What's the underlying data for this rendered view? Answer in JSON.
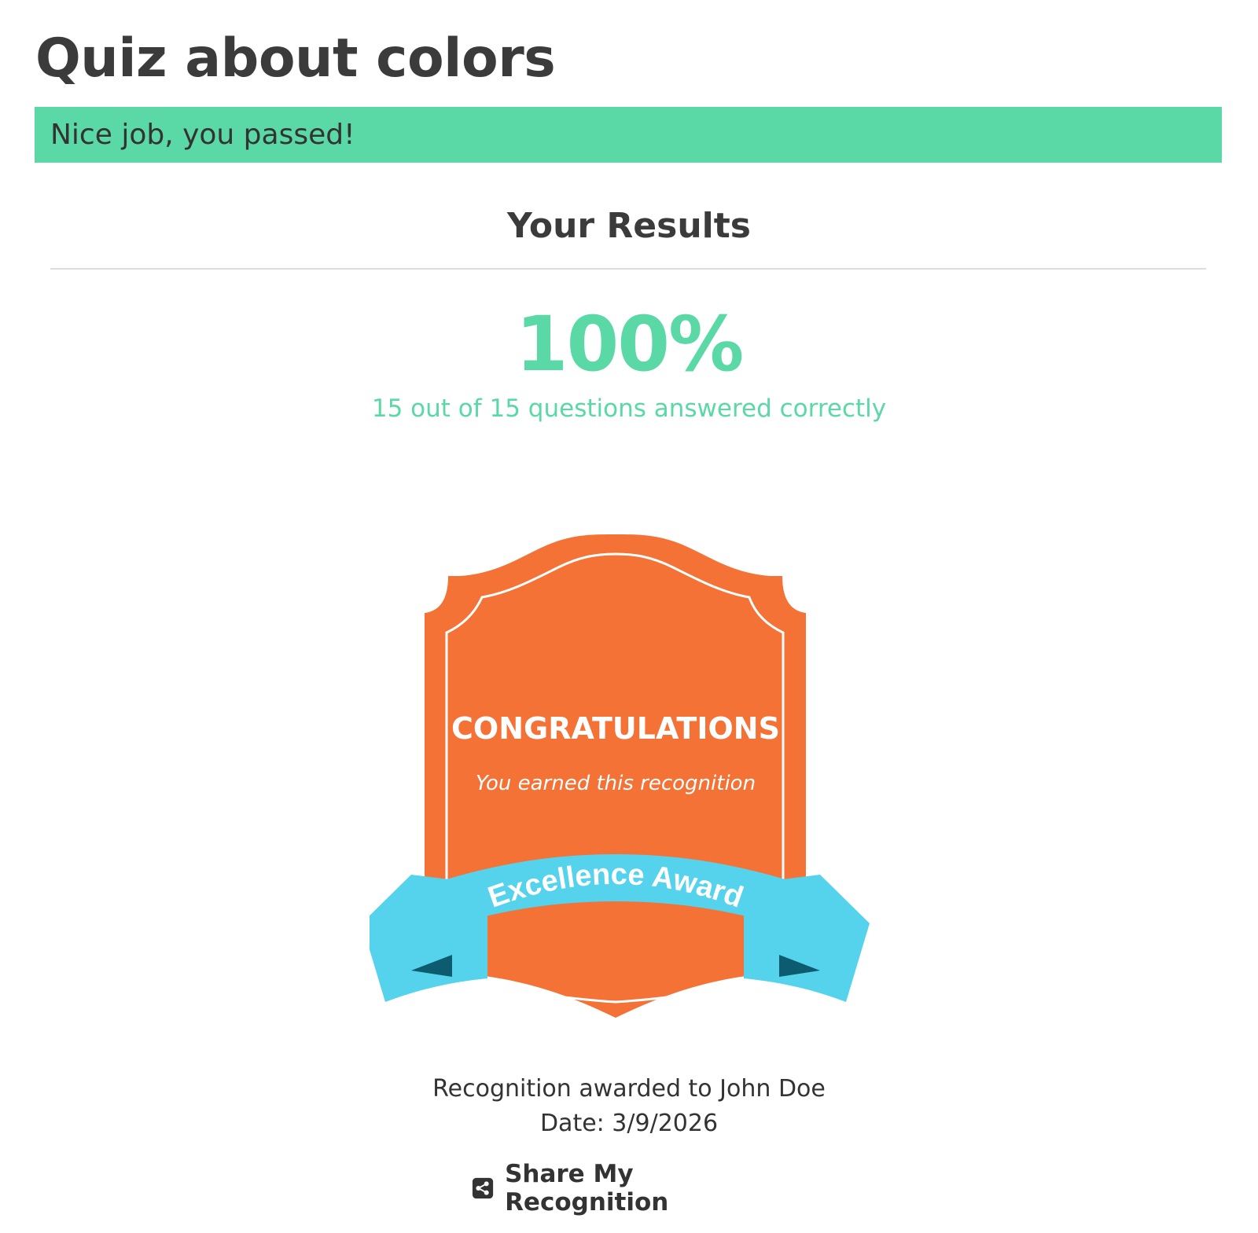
{
  "page": {
    "title": "Quiz about colors"
  },
  "banner": {
    "message": "Nice job, you passed!",
    "color": "#5ad9a6"
  },
  "results": {
    "heading": "Your Results",
    "score_percent": "100%",
    "score_detail": "15 out of 15 questions answered correctly",
    "accent_color": "#5ad9a6"
  },
  "award": {
    "title": "CONGRATULATIONS",
    "subtitle": "You earned this recognition",
    "ribbon_text": "Excellence Award",
    "badge_color": "#f47235",
    "ribbon_color": "#55d2ec",
    "ribbon_shadow_color": "#0d5b6e"
  },
  "recognition": {
    "awarded_to": "Recognition awarded to John Doe",
    "date": "Date: 3/9/2026"
  },
  "share": {
    "label": "Share My Recognition",
    "icon": "share-icon"
  }
}
